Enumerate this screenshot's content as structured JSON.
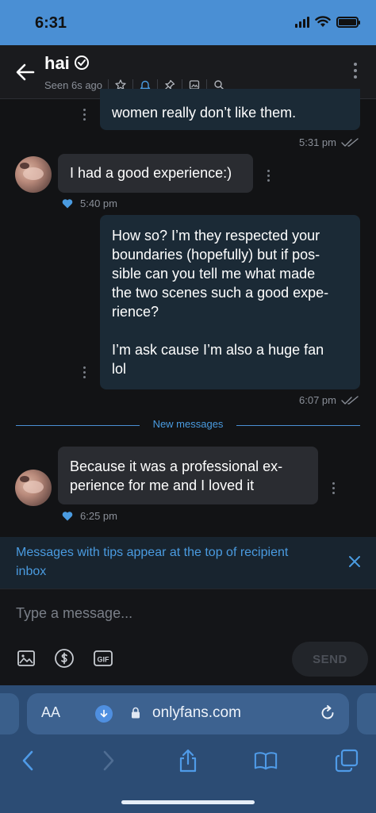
{
  "status_bar": {
    "time": "6:31"
  },
  "header": {
    "contact_name": "hai",
    "last_seen": "Seen 6s ago",
    "icons": [
      "back-arrow-icon",
      "verified-icon",
      "star-icon",
      "bell-icon",
      "pin-icon",
      "image-icon",
      "search-icon",
      "more-vertical-icon"
    ]
  },
  "messages": [
    {
      "direction": "out",
      "text": "women really don’t like them.",
      "time": "5:31 pm",
      "status": "read"
    },
    {
      "direction": "in",
      "text": "I had a good experience:)",
      "time": "5:40 pm",
      "liked": true
    },
    {
      "direction": "out",
      "lines": [
        "How so? I’m they respected your",
        "boundaries (hopefully) but if pos-",
        "sible can you tell me what made",
        "the two scenes such a good expe-",
        "rience?",
        "",
        "I’m ask cause I’m also a huge fan",
        "lol"
      ],
      "time": "6:07 pm",
      "status": "read"
    },
    {
      "direction": "in",
      "lines": [
        "Because it was a professional ex-",
        "perience for me and I loved it"
      ],
      "time": "6:25 pm",
      "liked": true
    }
  ],
  "divider_label": "New messages",
  "tip_banner": {
    "text": "Messages with tips appear at the top of recipient inbox"
  },
  "composer": {
    "placeholder": "Type a message...",
    "send_label": "SEND",
    "tools": [
      "image-icon",
      "dollar-icon",
      "gif-icon"
    ]
  },
  "safari": {
    "aa_label": "AA",
    "url": "onlyfans.com"
  },
  "colors": {
    "accent": "#4a9be0",
    "status_bar": "#4a8fd4",
    "outgoing_bubble": "#1b2a36",
    "incoming_bubble": "#2a2c31",
    "like": "#4a9be0"
  }
}
